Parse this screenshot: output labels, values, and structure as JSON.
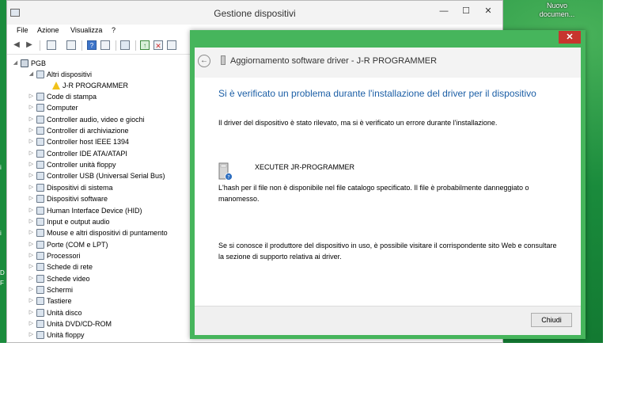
{
  "desktop": {
    "icon_label_line1": "Nuovo",
    "icon_label_line2": "documen...",
    "edge_glyphs": [
      "i",
      "i",
      "D",
      "F"
    ]
  },
  "devmgr": {
    "title": "Gestione dispositivi",
    "caption": {
      "minimize": "—",
      "maximize": "☐",
      "close": "✕"
    },
    "menu": [
      "File",
      "Azione",
      "Visualizza",
      "?"
    ],
    "toolbar_icons": [
      "back-icon",
      "forward-icon",
      "properties-icon",
      "view-icon",
      "help-icon",
      "computer-icon",
      "update-driver-icon",
      "uninstall-icon",
      "scan-hardware-icon"
    ],
    "tree": {
      "root": "PGB",
      "other_devices": "Altri dispositivi",
      "problem_device": "J-R PROGRAMMER",
      "categories": [
        "Code di stampa",
        "Computer",
        "Controller audio, video e giochi",
        "Controller di archiviazione",
        "Controller host IEEE 1394",
        "Controller IDE ATA/ATAPI",
        "Controller unità floppy",
        "Controller USB (Universal Serial Bus)",
        "Dispositivi di sistema",
        "Dispositivi software",
        "Human Interface Device (HID)",
        "Input e output audio",
        "Mouse e altri dispositivi di puntamento",
        "Porte (COM e LPT)",
        "Processori",
        "Schede di rete",
        "Schede video",
        "Schermi",
        "Tastiere",
        "Unità disco",
        "Unità DVD/CD-ROM",
        "Unità floppy"
      ]
    }
  },
  "dialog": {
    "close": "✕",
    "header_title": "Aggiornamento software driver - J-R PROGRAMMER",
    "heading": "Si è verificato un problema durante l'installazione del driver per il dispositivo",
    "detected_text": "Il driver del dispositivo è stato rilevato, ma si è verificato un errore durante l'installazione.",
    "device_name": "XECUTER JR-PROGRAMMER",
    "hash_error_text": "L'hash per il file non è disponibile nel file catalogo specificato. Il file è probabilmente danneggiato o manomesso.",
    "support_text": "Se si conosce il produttore del dispositivo in uso, è possibile visitare il corrispondente sito Web e consultare la sezione di supporto relativa ai driver.",
    "close_button": "Chiudi"
  },
  "colors": {
    "desktop": "#16893a",
    "dialog_frame": "#46b55c",
    "dialog_close": "#c7352e",
    "heading_blue": "#1c5fa6",
    "warning_yellow": "#f1c21b"
  }
}
